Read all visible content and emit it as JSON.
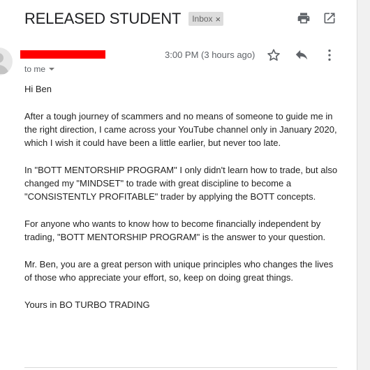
{
  "email": {
    "subject": "RELEASED STUDENT",
    "label": "Inbox",
    "label_close": "×",
    "time": "3:00 PM (3 hours ago)",
    "recipient": "to me",
    "body": [
      "Hi Ben",
      "After a tough journey of scammers and no means of someone to guide me in the right direction, I came across your YouTube channel only in January 2020, which I wish it could have been a little earlier, but never too late.",
      "In \"BOTT MENTORSHIP PROGRAM\" I only didn't learn how to trade, but also changed my \"MINDSET\" to trade with great discipline to become a \"CONSISTENTLY PROFITABLE\" trader by applying the BOTT concepts.",
      "For anyone who wants to know how to become financially independent by trading,  \"BOTT MENTORSHIP PROGRAM\" is the answer to your question.",
      "Mr. Ben, you are a great person with unique principles who changes the lives of those who appreciate your effort, so, keep on doing great things.",
      "Yours in BO TURBO TRADING"
    ]
  },
  "icons": {
    "print": "print-icon",
    "open_new_window": "open-in-new-window-icon",
    "star": "star-icon",
    "reply": "reply-icon",
    "more": "more-vertical-icon",
    "avatar": "default-avatar-icon"
  },
  "colors": {
    "sender_redaction": "#ff0000",
    "icon_gray": "#5f6368",
    "label_chip": "#dddddd"
  }
}
